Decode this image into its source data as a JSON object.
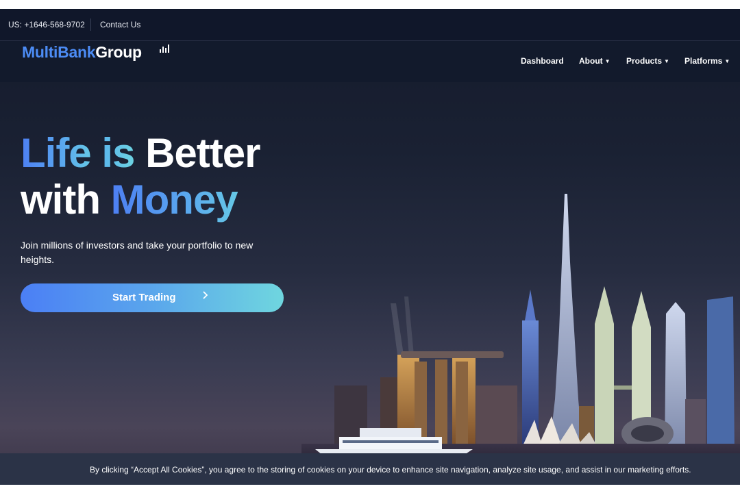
{
  "topbar": {
    "phone": "US: +1646-568-9702",
    "contact_label": "Contact Us"
  },
  "brand": {
    "name_part1": "MultiBank",
    "name_part2": "Group",
    "accent_color": "#4c8cf5"
  },
  "nav": {
    "items": [
      {
        "label": "Dashboard",
        "has_dropdown": false
      },
      {
        "label": "About",
        "has_dropdown": true
      },
      {
        "label": "Products",
        "has_dropdown": true
      },
      {
        "label": "Platforms",
        "has_dropdown": true
      }
    ],
    "dropdown_glyph": "▼"
  },
  "hero": {
    "title_w1": "Life",
    "title_w2": "is",
    "title_w3": "Better",
    "title_w4": "with",
    "title_w5": "Money",
    "subtitle": "Join millions of investors and take your portfolio to new heights.",
    "cta_label": "Start Trading",
    "cta_icon": "chevron-right-icon"
  },
  "cookie_banner": {
    "text": "By clicking “Accept All Cookies”, you agree to the storing of cookies on your device to enhance site navigation, analyze site usage, and assist in our marketing efforts."
  },
  "colors": {
    "background_dark": "#141a2b",
    "gradient_start": "#4b7ff5",
    "gradient_end": "#6fd6df",
    "cookie_banner_bg": "#2b3347"
  }
}
